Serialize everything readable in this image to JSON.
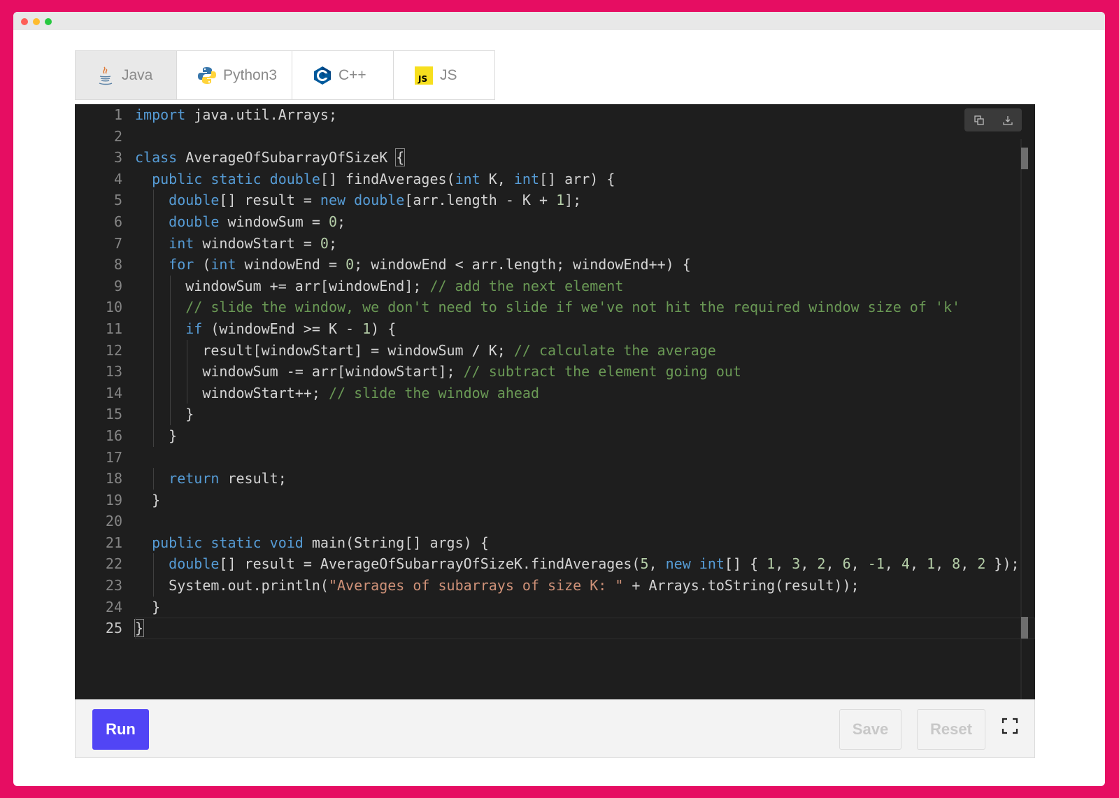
{
  "tabs": [
    {
      "label": "Java",
      "icon": "java-icon",
      "active": true
    },
    {
      "label": "Python3",
      "icon": "python-icon",
      "active": false
    },
    {
      "label": "C++",
      "icon": "cpp-icon",
      "active": false
    },
    {
      "label": "JS",
      "icon": "js-icon",
      "active": false
    }
  ],
  "editor": {
    "current_line": 25,
    "line_numbers": [
      "1",
      "2",
      "3",
      "4",
      "5",
      "6",
      "7",
      "8",
      "9",
      "10",
      "11",
      "12",
      "13",
      "14",
      "15",
      "16",
      "17",
      "18",
      "19",
      "20",
      "21",
      "22",
      "23",
      "24",
      "25"
    ],
    "lines": [
      [
        [
          "kw",
          "import"
        ],
        [
          "p",
          " java.util.Arrays;"
        ]
      ],
      [],
      [
        [
          "kw",
          "class"
        ],
        [
          "p",
          " AverageOfSubarrayOfSizeK "
        ],
        [
          "bx",
          "{"
        ]
      ],
      [
        [
          "p",
          "  "
        ],
        [
          "kw",
          "public static double"
        ],
        [
          "p",
          "[] findAverages("
        ],
        [
          "kw",
          "int"
        ],
        [
          "p",
          " K, "
        ],
        [
          "kw",
          "int"
        ],
        [
          "p",
          "[] arr) {"
        ]
      ],
      [
        [
          "p",
          "    "
        ],
        [
          "kw",
          "double"
        ],
        [
          "p",
          "[] result = "
        ],
        [
          "kw",
          "new double"
        ],
        [
          "p",
          "[arr.length - K + "
        ],
        [
          "nm",
          "1"
        ],
        [
          "p",
          "];"
        ]
      ],
      [
        [
          "p",
          "    "
        ],
        [
          "kw",
          "double"
        ],
        [
          "p",
          " windowSum = "
        ],
        [
          "nm",
          "0"
        ],
        [
          "p",
          ";"
        ]
      ],
      [
        [
          "p",
          "    "
        ],
        [
          "kw",
          "int"
        ],
        [
          "p",
          " windowStart = "
        ],
        [
          "nm",
          "0"
        ],
        [
          "p",
          ";"
        ]
      ],
      [
        [
          "p",
          "    "
        ],
        [
          "kw",
          "for"
        ],
        [
          "p",
          " ("
        ],
        [
          "kw",
          "int"
        ],
        [
          "p",
          " windowEnd = "
        ],
        [
          "nm",
          "0"
        ],
        [
          "p",
          "; windowEnd < arr.length; windowEnd++) {"
        ]
      ],
      [
        [
          "p",
          "      windowSum += arr[windowEnd]; "
        ],
        [
          "cm",
          "// add the next element"
        ]
      ],
      [
        [
          "p",
          "      "
        ],
        [
          "cm",
          "// slide the window, we don't need to slide if we've not hit the required window size of 'k'"
        ]
      ],
      [
        [
          "p",
          "      "
        ],
        [
          "kw",
          "if"
        ],
        [
          "p",
          " (windowEnd >= K - "
        ],
        [
          "nm",
          "1"
        ],
        [
          "p",
          ") {"
        ]
      ],
      [
        [
          "p",
          "        result[windowStart] = windowSum / K; "
        ],
        [
          "cm",
          "// calculate the average"
        ]
      ],
      [
        [
          "p",
          "        windowSum -= arr[windowStart]; "
        ],
        [
          "cm",
          "// subtract the element going out"
        ]
      ],
      [
        [
          "p",
          "        windowStart++; "
        ],
        [
          "cm",
          "// slide the window ahead"
        ]
      ],
      [
        [
          "p",
          "      }"
        ]
      ],
      [
        [
          "p",
          "    }"
        ]
      ],
      [],
      [
        [
          "p",
          "    "
        ],
        [
          "kw",
          "return"
        ],
        [
          "p",
          " result;"
        ]
      ],
      [
        [
          "p",
          "  }"
        ]
      ],
      [],
      [
        [
          "p",
          "  "
        ],
        [
          "kw",
          "public static void"
        ],
        [
          "p",
          " main(String[] args) {"
        ]
      ],
      [
        [
          "p",
          "    "
        ],
        [
          "kw",
          "double"
        ],
        [
          "p",
          "[] result = AverageOfSubarrayOfSizeK.findAverages("
        ],
        [
          "nm",
          "5"
        ],
        [
          "p",
          ", "
        ],
        [
          "kw",
          "new int"
        ],
        [
          "p",
          "[] { "
        ],
        [
          "nm",
          "1"
        ],
        [
          "p",
          ", "
        ],
        [
          "nm",
          "3"
        ],
        [
          "p",
          ", "
        ],
        [
          "nm",
          "2"
        ],
        [
          "p",
          ", "
        ],
        [
          "nm",
          "6"
        ],
        [
          "p",
          ", "
        ],
        [
          "nm",
          "-1"
        ],
        [
          "p",
          ", "
        ],
        [
          "nm",
          "4"
        ],
        [
          "p",
          ", "
        ],
        [
          "nm",
          "1"
        ],
        [
          "p",
          ", "
        ],
        [
          "nm",
          "8"
        ],
        [
          "p",
          ", "
        ],
        [
          "nm",
          "2"
        ],
        [
          "p",
          " });"
        ]
      ],
      [
        [
          "p",
          "    System.out.println("
        ],
        [
          "st",
          "\"Averages of subarrays of size K: \""
        ],
        [
          "p",
          " + Arrays.toString(result));"
        ]
      ],
      [
        [
          "p",
          "  }"
        ]
      ],
      [
        [
          "bx",
          "}"
        ]
      ]
    ],
    "toolbar": {
      "copy_icon": "copy-icon",
      "download_icon": "download-icon"
    }
  },
  "footer": {
    "run_label": "Run",
    "save_label": "Save",
    "reset_label": "Reset",
    "fullscreen_icon": "fullscreen-icon"
  }
}
